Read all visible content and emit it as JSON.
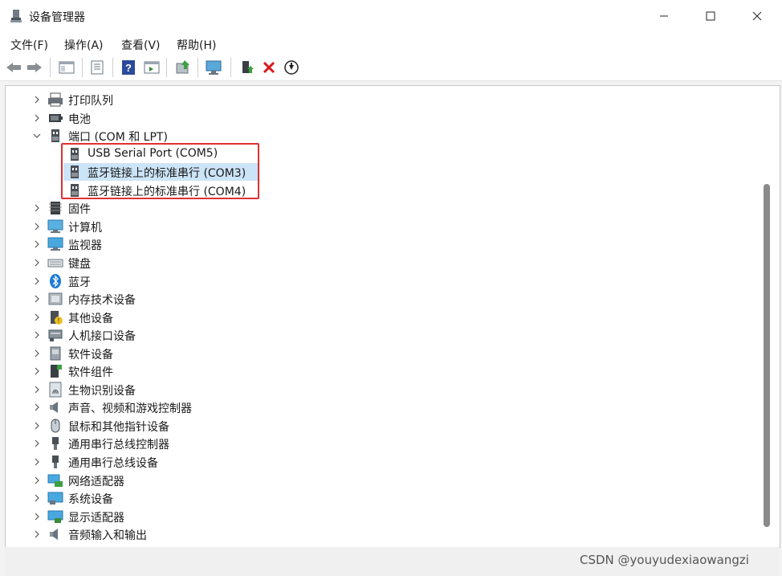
{
  "window": {
    "title": "设备管理器"
  },
  "menu": [
    {
      "label": "文件(F)"
    },
    {
      "label": "操作(A)"
    },
    {
      "label": "查看(V)"
    },
    {
      "label": "帮助(H)"
    }
  ],
  "tree": [
    {
      "label": "打印队列",
      "icon": "printer-icon",
      "expanded": false
    },
    {
      "label": "电池",
      "icon": "battery-icon",
      "expanded": false
    },
    {
      "label": "端口 (COM 和 LPT)",
      "icon": "port-icon",
      "expanded": true
    },
    {
      "label": "USB Serial Port (COM5)",
      "icon": "port-icon",
      "child": true
    },
    {
      "label": "蓝牙链接上的标准串行 (COM3)",
      "icon": "port-icon",
      "child": true,
      "selected": true
    },
    {
      "label": "蓝牙链接上的标准串行 (COM4)",
      "icon": "port-icon",
      "child": true
    },
    {
      "label": "固件",
      "icon": "firmware-icon",
      "expanded": false
    },
    {
      "label": "计算机",
      "icon": "computer-icon",
      "expanded": false
    },
    {
      "label": "监视器",
      "icon": "monitor-icon",
      "expanded": false
    },
    {
      "label": "键盘",
      "icon": "keyboard-icon",
      "expanded": false
    },
    {
      "label": "蓝牙",
      "icon": "bluetooth-icon",
      "expanded": false
    },
    {
      "label": "内存技术设备",
      "icon": "memory-icon",
      "expanded": false
    },
    {
      "label": "其他设备",
      "icon": "unknown-device-icon",
      "expanded": false
    },
    {
      "label": "人机接口设备",
      "icon": "hid-icon",
      "expanded": false
    },
    {
      "label": "软件设备",
      "icon": "software-device-icon",
      "expanded": false
    },
    {
      "label": "软件组件",
      "icon": "software-component-icon",
      "expanded": false
    },
    {
      "label": "生物识别设备",
      "icon": "fingerprint-icon",
      "expanded": false
    },
    {
      "label": "声音、视频和游戏控制器",
      "icon": "speaker-icon",
      "expanded": false
    },
    {
      "label": "鼠标和其他指针设备",
      "icon": "mouse-icon",
      "expanded": false
    },
    {
      "label": "通用串行总线控制器",
      "icon": "usb-icon",
      "expanded": false
    },
    {
      "label": "通用串行总线设备",
      "icon": "usb-icon",
      "expanded": false
    },
    {
      "label": "网络适配器",
      "icon": "network-icon",
      "expanded": false
    },
    {
      "label": "系统设备",
      "icon": "system-icon",
      "expanded": false
    },
    {
      "label": "显示适配器",
      "icon": "display-adapter-icon",
      "expanded": false
    },
    {
      "label": "音频输入和输出",
      "icon": "audio-icon",
      "expanded": false
    }
  ],
  "watermark": "CSDN @youyudexiaowangzi",
  "colors": {
    "highlight": "#e03030",
    "selection": "#cce4f7"
  }
}
